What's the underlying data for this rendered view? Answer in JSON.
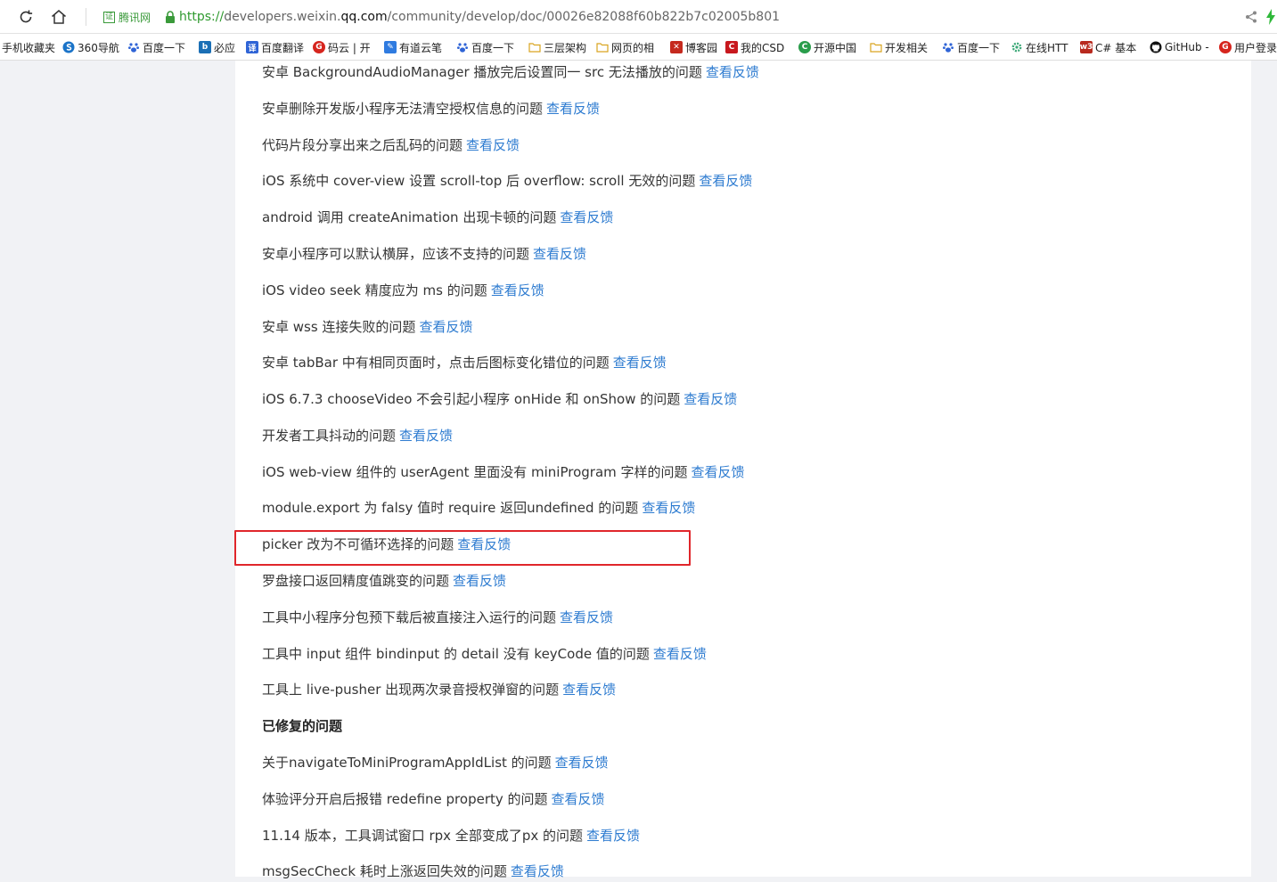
{
  "address_bar": {
    "cert_label": "证",
    "cert_name": "腾讯网",
    "url_scheme": "https://",
    "url_host_prefix": "developers.weixin.",
    "url_host": "qq.com",
    "url_path": "/community/develop/doc/00026e82088f60b822b7c02005b801"
  },
  "bookmarks": [
    {
      "label": "手机收藏夹",
      "icon": "none",
      "color": ""
    },
    {
      "label": "360导航",
      "icon": "s",
      "color": "#1a73c8"
    },
    {
      "label": "百度一下",
      "icon": "paw",
      "color": "#2f64d6"
    },
    {
      "label": "必应",
      "icon": "b",
      "color": "#1b6fb5"
    },
    {
      "label": "百度翻译",
      "icon": "译",
      "color": "#2f64d6"
    },
    {
      "label": "码云 | 开",
      "icon": "G",
      "color": "#d6251e"
    },
    {
      "label": "有道云笔",
      "icon": "note",
      "color": "#2f7be0"
    },
    {
      "label": "百度一下",
      "icon": "paw",
      "color": "#2f64d6"
    },
    {
      "label": "三层架构",
      "icon": "folder",
      "color": "#e8b530"
    },
    {
      "label": "网页的相",
      "icon": "folder",
      "color": "#e8b530"
    },
    {
      "label": "博客园",
      "icon": "x",
      "color": "#c52a1e"
    },
    {
      "label": "我的CSD",
      "icon": "C",
      "color": "#c8181e"
    },
    {
      "label": "开源中国",
      "icon": "C",
      "color": "#2a9d4b"
    },
    {
      "label": "开发相关",
      "icon": "folder",
      "color": "#e8b530"
    },
    {
      "label": "百度一下",
      "icon": "paw",
      "color": "#2f64d6"
    },
    {
      "label": "在线HTT",
      "icon": "gear",
      "color": "#3aa776"
    },
    {
      "label": "C# 基本",
      "icon": "w3c",
      "color": "#b82a1e"
    },
    {
      "label": "GitHub -",
      "icon": "github",
      "color": "#111111"
    },
    {
      "label": "用户登录",
      "icon": "G",
      "color": "#d6251e"
    }
  ],
  "link_label": "查看反馈",
  "rows": [
    {
      "text": "安卓 BackgroundAudioManager 播放完后设置同一 src 无法播放的问题",
      "link": true
    },
    {
      "text": "安卓删除开发版小程序无法清空授权信息的问题",
      "link": true
    },
    {
      "text": "代码片段分享出来之后乱码的问题",
      "link": true
    },
    {
      "text": "iOS 系统中 cover-view 设置 scroll-top 后 overflow: scroll 无效的问题",
      "link": true
    },
    {
      "text": "android 调用 createAnimation 出现卡顿的问题",
      "link": true
    },
    {
      "text": "安卓小程序可以默认横屏，应该不支持的问题",
      "link": true
    },
    {
      "text": "iOS video seek 精度应为 ms 的问题",
      "link": true
    },
    {
      "text": "安卓 wss 连接失败的问题",
      "link": true
    },
    {
      "text": "安卓 tabBar 中有相同页面时，点击后图标变化错位的问题",
      "link": true
    },
    {
      "text": "iOS 6.7.3 chooseVideo 不会引起小程序 onHide 和 onShow 的问题",
      "link": true
    },
    {
      "text": "开发者工具抖动的问题",
      "link": true
    },
    {
      "text": "iOS web-view 组件的 userAgent 里面没有 miniProgram 字样的问题",
      "link": true
    },
    {
      "text": "module.export 为 falsy 值时 require 返回undefined 的问题",
      "link": true
    },
    {
      "text": "picker 改为不可循环选择的问题",
      "link": true
    },
    {
      "text": "罗盘接口返回精度值跳变的问题",
      "link": true
    },
    {
      "text": "工具中小程序分包预下载后被直接注入运行的问题",
      "link": true
    },
    {
      "text": "工具中 input 组件 bindinput 的 detail 没有 keyCode 值的问题",
      "link": true
    },
    {
      "text": "工具上 live-pusher 出现两次录音授权弹窗的问题",
      "link": true
    },
    {
      "text": "已修复的问题",
      "link": false
    },
    {
      "text": "关于navigateToMiniProgramAppIdList 的问题",
      "link": true
    },
    {
      "text": "体验评分开启后报错 redefine property 的问题",
      "link": true
    },
    {
      "text": "11.14 版本，工具调试窗口 rpx 全部变成了px 的问题",
      "link": true
    },
    {
      "text": "msgSecCheck 耗时上涨返回失效的问题",
      "link": true
    }
  ],
  "highlight_color": "#e0262b",
  "link_color": "#2d7bd0"
}
